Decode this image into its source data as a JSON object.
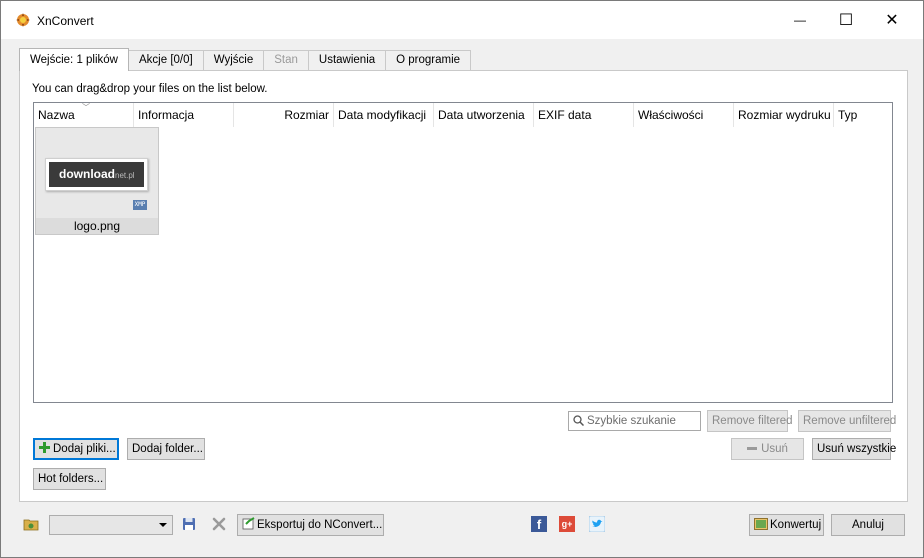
{
  "window": {
    "title": "XnConvert",
    "minimize_glyph": "—",
    "maximize_glyph": "☐",
    "close_glyph": "✕"
  },
  "tabs": [
    {
      "label": "Wejście: 1 plików",
      "state": "active"
    },
    {
      "label": "Akcje [0/0]",
      "state": "normal"
    },
    {
      "label": "Wyjście",
      "state": "normal"
    },
    {
      "label": "Stan",
      "state": "disabled"
    },
    {
      "label": "Ustawienia",
      "state": "normal"
    },
    {
      "label": "O programie",
      "state": "normal"
    }
  ],
  "input": {
    "hint": "You can drag&drop your files on the list below.",
    "columns": [
      "Nazwa",
      "Informacja",
      "Rozmiar",
      "Data modyfikacji",
      "Data utworzenia",
      "EXIF data",
      "Właściwości",
      "Rozmiar wydruku",
      "Typ"
    ],
    "files": [
      {
        "name": "logo.png",
        "thumb_text": "download",
        "thumb_suffix": "net.pl",
        "badge": "XMP"
      }
    ],
    "search_placeholder": "Szybkie szukanie",
    "remove_filtered": "Remove filtered",
    "remove_unfiltered": "Remove unfiltered",
    "add_files": "Dodaj pliki...",
    "add_folder": "Dodaj folder...",
    "remove": "Usuń",
    "remove_all": "Usuń wszystkie",
    "hot_folders": "Hot folders..."
  },
  "footer": {
    "preset_value": "",
    "export": "Eksportuj do NConvert...",
    "convert": "Konwertuj",
    "cancel": "Anuluj"
  },
  "colors": {
    "accent": "#0078d7",
    "facebook": "#3b5998",
    "google_plus": "#dd4b39",
    "twitter": "#1da1f2"
  }
}
